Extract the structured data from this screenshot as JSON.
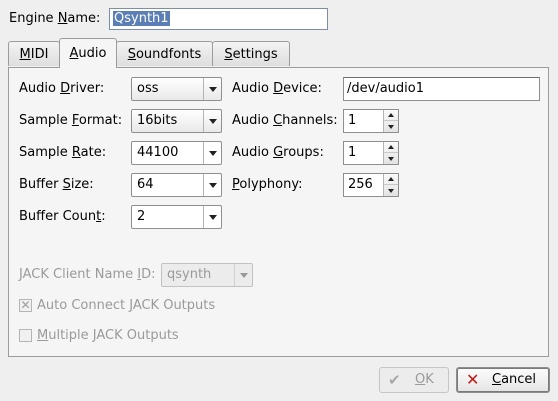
{
  "engine": {
    "label": "Engine Name:",
    "underline_char": "N",
    "value": "Qsynth1"
  },
  "tabs": [
    {
      "label": "MIDI",
      "u": "M",
      "rest": "IDI"
    },
    {
      "label": "Audio",
      "u": "A",
      "rest": "udio"
    },
    {
      "label": "Soundfonts",
      "u": "S",
      "rest": "oundfonts"
    },
    {
      "label": "Settings",
      "u": "S",
      "rest": "ettings"
    }
  ],
  "audio": {
    "driver": {
      "pre": "Audio ",
      "u": "D",
      "post": "river:",
      "value": "oss"
    },
    "format": {
      "pre": "Sample ",
      "u": "F",
      "post": "ormat:",
      "value": "16bits"
    },
    "rate": {
      "pre": "Sample ",
      "u": "R",
      "post": "ate:",
      "value": "44100"
    },
    "buffer_size": {
      "pre": "Buffer ",
      "u": "S",
      "post": "ize:",
      "value": "64"
    },
    "buffer_count": {
      "pre": "Buffer Coun",
      "u": "t",
      "post": ":",
      "value": "2"
    },
    "device": {
      "pre": "Audio ",
      "u": "D",
      "post": "evice:",
      "value": "/dev/audio1"
    },
    "channels": {
      "pre": "Audio ",
      "u": "C",
      "post": "hannels:",
      "value": "1"
    },
    "groups": {
      "pre": "Audio ",
      "u": "G",
      "post": "roups:",
      "value": "1"
    },
    "polyphony": {
      "pre": "",
      "u": "P",
      "post": "olyphony:",
      "value": "256"
    },
    "jack_client": {
      "pre": "JACK Client Name ",
      "u": "I",
      "post": "D:",
      "value": "qsynth"
    },
    "auto_connect": {
      "pre": "Auto Connect ",
      "u": "J",
      "post": "ACK Outputs",
      "checked": true
    },
    "multiple_jack": {
      "pre": "",
      "u": "M",
      "post": "ultiple JACK Outputs",
      "checked": false
    }
  },
  "buttons": {
    "ok": {
      "label": "OK",
      "u": "O",
      "rest": "K"
    },
    "cancel": {
      "label": "Cancel",
      "u": "C",
      "rest": "ancel"
    }
  },
  "colors": {
    "selection": "#5b7fb5",
    "cancel_icon": "#c01818"
  }
}
